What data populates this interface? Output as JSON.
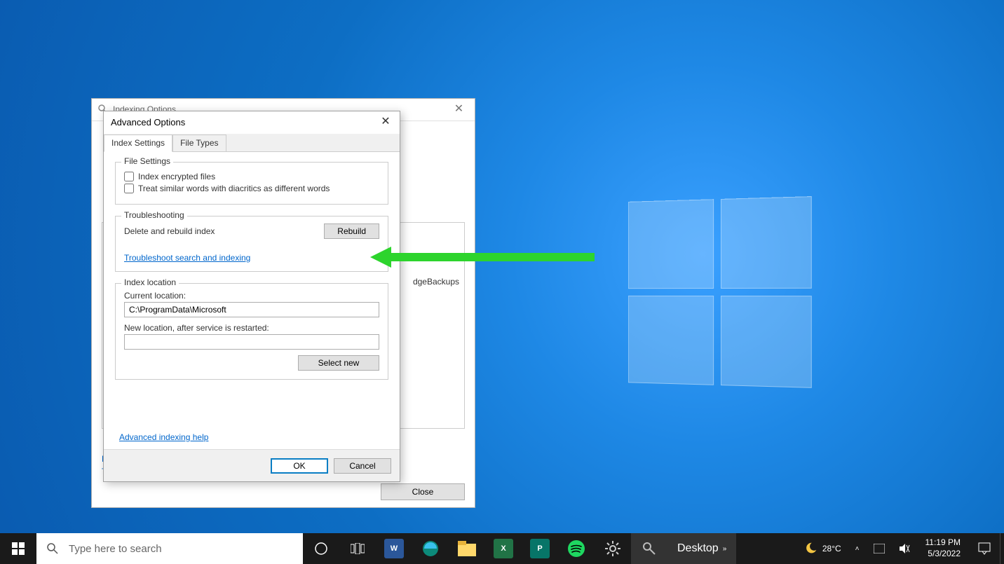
{
  "back_window": {
    "title": "Indexing Options",
    "list_item": "dgeBackups",
    "help_initial": "H",
    "trouble_initial": "T",
    "close_label": "Close"
  },
  "dialog": {
    "title": "Advanced Options",
    "tabs": {
      "settings": "Index Settings",
      "filetypes": "File Types"
    },
    "file_settings": {
      "legend": "File Settings",
      "encrypted": "Index encrypted files",
      "diacritics": "Treat similar words with diacritics as different words"
    },
    "troubleshooting": {
      "legend": "Troubleshooting",
      "delete_label": "Delete and rebuild index",
      "rebuild_label": "Rebuild",
      "link": "Troubleshoot search and indexing"
    },
    "location": {
      "legend": "Index location",
      "current_label": "Current location:",
      "current_value": "C:\\ProgramData\\Microsoft",
      "new_label": "New location, after service is restarted:",
      "new_value": "",
      "select_new": "Select new"
    },
    "adv_help": "Advanced indexing help",
    "ok": "OK",
    "cancel": "Cancel"
  },
  "taskbar": {
    "search_placeholder": "Type here to search",
    "desktop_label": "Desktop",
    "weather": "28°C",
    "time": "11:19 PM",
    "date": "5/3/2022"
  }
}
